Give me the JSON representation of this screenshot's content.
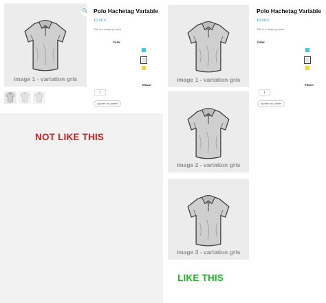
{
  "left_example": {
    "main_image_caption": "image 1 - variation gris",
    "zoom_icon": "zoom-icon",
    "thumbnails": [
      {
        "name": "thumbnail-1"
      },
      {
        "name": "thumbnail-2"
      },
      {
        "name": "thumbnail-3"
      }
    ],
    "product": {
      "title": "Polo Hachetag Variable",
      "price": "10,00 €",
      "description": "This is a simple product.",
      "color_label": "Color",
      "clear_label": "Effacer",
      "quantity": "1",
      "add_to_cart": "Ajouter au panier",
      "swatches": [
        "#49c6e5",
        "#e6e6e6",
        "#f5d535"
      ]
    },
    "verdict": "NOT LIKE THIS",
    "verdict_color": "#d21f1f"
  },
  "right_example": {
    "images": [
      {
        "caption": "image 1 - variation gris"
      },
      {
        "caption": "image 2 - variation gris"
      },
      {
        "caption": "image 3 - variation gris"
      }
    ],
    "product": {
      "title": "Polo Hachetag Variable",
      "price": "10,00 €",
      "description": "This is a simple product.",
      "color_label": "Color",
      "clear_label": "Effacer",
      "quantity": "1",
      "add_to_cart": "Ajouter au panier",
      "swatches": [
        "#49c6e5",
        "#e6e6e6",
        "#f5d535"
      ]
    },
    "verdict": "LIKE THIS",
    "verdict_color": "#22bb22"
  }
}
